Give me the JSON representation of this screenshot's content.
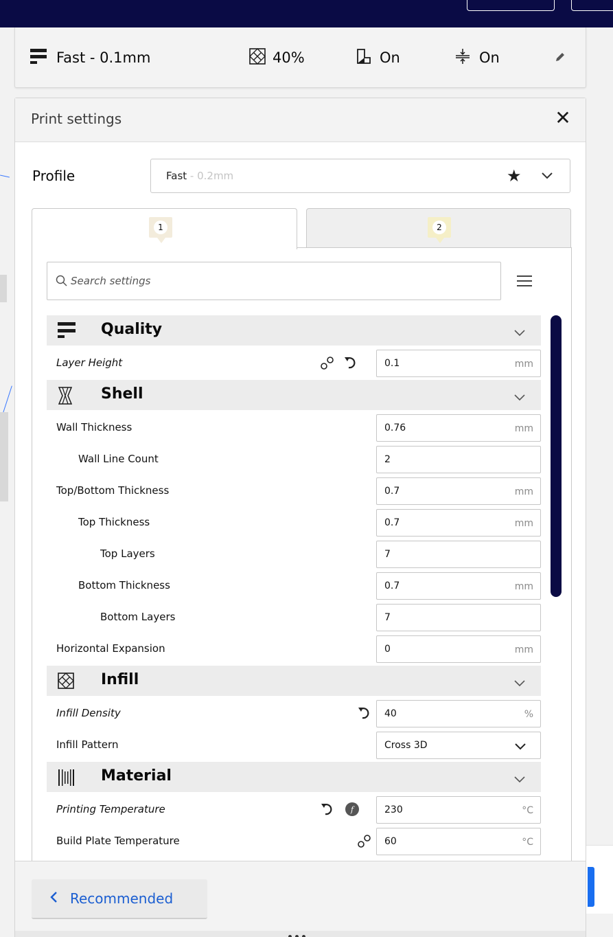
{
  "summary": {
    "profile": "Fast - 0.1mm",
    "infill": "40%",
    "support": "On",
    "adhesion": "On"
  },
  "panel": {
    "title": "Print settings",
    "profile_label": "Profile",
    "profile_name": "Fast",
    "profile_layer": " - 0.2mm",
    "tabs": [
      {
        "label": "1"
      },
      {
        "label": "2"
      }
    ],
    "search_placeholder": "Search settings"
  },
  "categories": {
    "quality": "Quality",
    "shell": "Shell",
    "infill": "Infill",
    "material": "Material"
  },
  "settings": {
    "layer_height": {
      "label": "Layer Height",
      "value": "0.1",
      "unit": "mm"
    },
    "wall_thickness": {
      "label": "Wall Thickness",
      "value": "0.76",
      "unit": "mm"
    },
    "wall_line_count": {
      "label": "Wall Line Count",
      "value": "2"
    },
    "top_bottom_thickness": {
      "label": "Top/Bottom Thickness",
      "value": "0.7",
      "unit": "mm"
    },
    "top_thickness": {
      "label": "Top Thickness",
      "value": "0.7",
      "unit": "mm"
    },
    "top_layers": {
      "label": "Top Layers",
      "value": "7"
    },
    "bottom_thickness": {
      "label": "Bottom Thickness",
      "value": "0.7",
      "unit": "mm"
    },
    "bottom_layers": {
      "label": "Bottom Layers",
      "value": "7"
    },
    "horizontal_expansion": {
      "label": "Horizontal Expansion",
      "value": "0",
      "unit": "mm"
    },
    "infill_density": {
      "label": "Infill Density",
      "value": "40",
      "unit": "%"
    },
    "infill_pattern": {
      "label": "Infill Pattern",
      "value": "Cross 3D"
    },
    "printing_temperature": {
      "label": "Printing Temperature",
      "value": "230",
      "unit": "°C"
    },
    "build_plate_temperature": {
      "label": "Build Plate Temperature",
      "value": "60",
      "unit": "°C"
    }
  },
  "footer": {
    "recommended_label": "Recommended"
  },
  "colors": {
    "accent_blue": "#196ef0",
    "top_bar": "#0a0b45",
    "scrollbar": "#0b0b44",
    "link_text": "#1b5ed1"
  }
}
